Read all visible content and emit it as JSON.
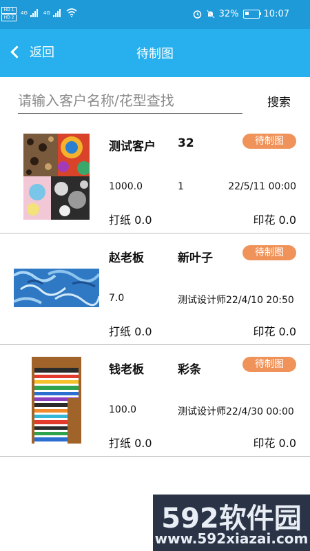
{
  "status_bar": {
    "sim1": "HD 1",
    "sim2": "HD 2",
    "net1": "4G",
    "net2": "4G",
    "battery": "32%",
    "time": "10:07"
  },
  "navbar": {
    "back_label": "返回",
    "title": "待制图"
  },
  "search": {
    "placeholder": "请输入客户名称/花型查找",
    "value": "",
    "button_label": "搜索"
  },
  "orders": [
    {
      "customer": "测试客户",
      "pattern": "32",
      "status": "待制图",
      "quantity": "1000.0",
      "designer": "1",
      "date": "22/5/11 00:00",
      "paper_label": "打纸",
      "paper_value": "0.0",
      "print_label": "印花",
      "print_value": "0.0"
    },
    {
      "customer": "赵老板",
      "pattern": "新叶子",
      "status": "待制图",
      "quantity": "7.0",
      "designer": "测试设计师",
      "date": "22/4/10 20:50",
      "paper_label": "打纸",
      "paper_value": "0.0",
      "print_label": "印花",
      "print_value": "0.0"
    },
    {
      "customer": "钱老板",
      "pattern": "彩条",
      "status": "待制图",
      "quantity": "100.0",
      "designer": "测试设计师",
      "date": "22/4/30 00:00",
      "paper_label": "打纸",
      "paper_value": "0.0",
      "print_label": "印花",
      "print_value": "0.0"
    }
  ],
  "watermark": {
    "brand": "592软件园",
    "url": "www.592xiazai.com"
  },
  "colors": {
    "status_bar": "#1e9ad9",
    "navbar": "#27b0ed",
    "badge": "#f0935a"
  }
}
